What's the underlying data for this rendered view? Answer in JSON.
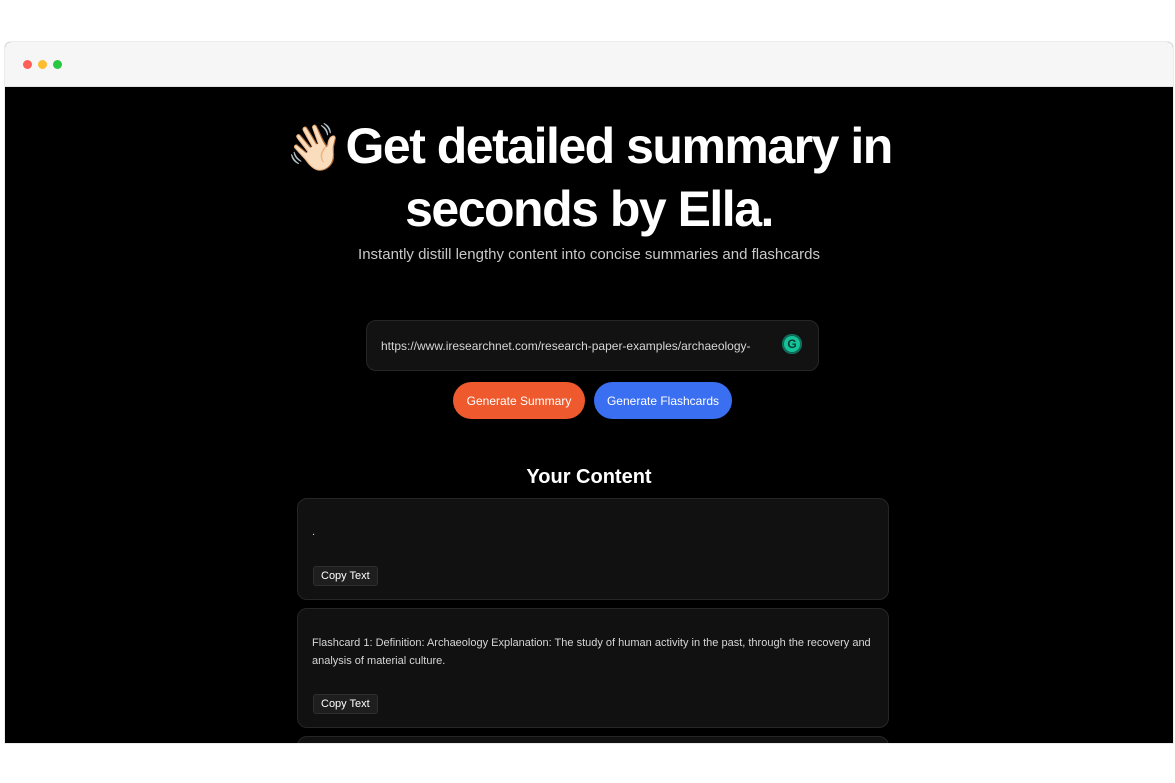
{
  "hero": {
    "emoji": "👋🏻",
    "title_line1": "Get detailed summary in",
    "title_line2": "seconds by Ella.",
    "subtitle": "Instantly distill lengthy content into concise summaries and flashcards"
  },
  "url_input": {
    "value": "https://www.iresearchnet.com/research-paper-examples/archaeology-",
    "icon": "grammarly-icon"
  },
  "buttons": {
    "summary": "Generate Summary",
    "flashcards": "Generate Flashcards"
  },
  "content": {
    "heading": "Your Content",
    "cards": [
      {
        "text": ".",
        "copy_label": "Copy Text"
      },
      {
        "text": "Flashcard 1: Definition: Archaeology Explanation: The study of human activity in the past, through the recovery and analysis of material culture.",
        "copy_label": "Copy Text"
      }
    ]
  },
  "colors": {
    "background": "#000000",
    "summary_button": "#ee5a2d",
    "flashcards_button": "#3a6ff2"
  }
}
